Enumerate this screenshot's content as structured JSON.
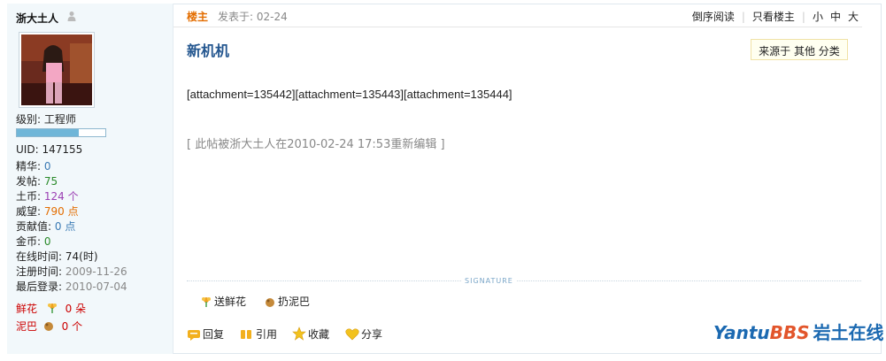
{
  "author": {
    "name": "浙大土人"
  },
  "profile": {
    "level_label": "级别:",
    "level_value": "工程师",
    "level_progress": 0.7,
    "uid_label": "UID:",
    "uid": "147155",
    "digest_label": "精华:",
    "digest": "0",
    "posts_label": "发帖:",
    "posts": "75",
    "coins_label": "土币:",
    "coins": "124 个",
    "prestige_label": "威望:",
    "prestige": "790 点",
    "contrib_label": "贡献值:",
    "contrib": "0 点",
    "gold_label": "金币:",
    "gold": "0",
    "online_label": "在线时间:",
    "online": "74(时)",
    "reg_label": "注册时间:",
    "reg": "2009-11-26",
    "last_label": "最后登录:",
    "last": "2010-07-04",
    "flowers_label": "鲜花",
    "flowers": "0 朵",
    "mud_label": "泥巴",
    "mud": "0 个"
  },
  "post": {
    "floor": "楼主",
    "posted": "发表于: 02-24",
    "reverse": "倒序阅读",
    "only_author": "只看楼主",
    "font_small": "小",
    "font_mid": "中",
    "font_big": "大",
    "title": "新机机",
    "source": "来源于 其他 分类",
    "body": "[attachment=135442][attachment=135443][attachment=135444]",
    "edit_note": "[ 此帖被浙大土人在2010-02-24 17:53重新编辑  ]",
    "signature_label": "SIGNATURE"
  },
  "actions": {
    "send_flower": "送鲜花",
    "throw_mud": "扔泥巴",
    "reply": "回复",
    "quote": "引用",
    "favorite": "收藏",
    "share": "分享"
  },
  "logo": {
    "part1": "Yantu",
    "part2": "BBS",
    "part3": "岩土在线"
  },
  "colors": {
    "title": "#23568f",
    "orange": "#e36d00",
    "green": "#2a8a2a",
    "blue": "#3b7bb5"
  }
}
